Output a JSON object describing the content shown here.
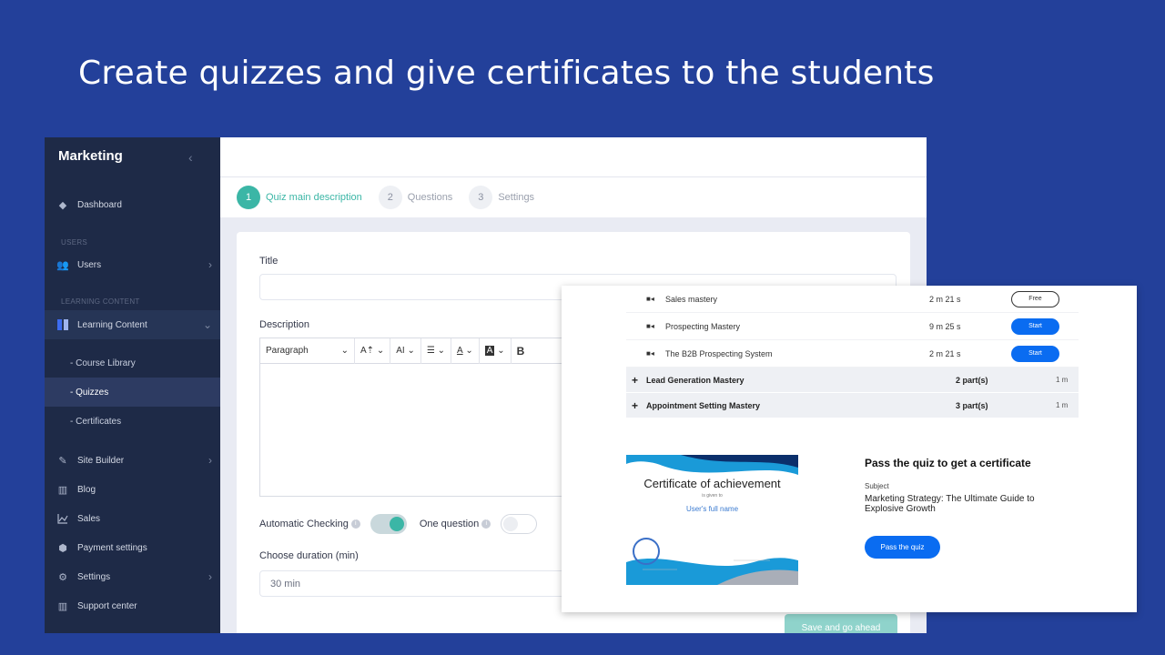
{
  "headline": "Create quizzes and give certificates to the students",
  "sidebar": {
    "brand": "Marketing",
    "section_users": "USERS",
    "section_learning": "LEARNING CONTENT",
    "items": {
      "dashboard": "Dashboard",
      "users": "Users",
      "learning_content": "Learning Content",
      "course_library": "- Course Library",
      "quizzes": "- Quizzes",
      "certificates": "- Certificates",
      "site_builder": "Site Builder",
      "blog": "Blog",
      "sales": "Sales",
      "payment_settings": "Payment settings",
      "settings": "Settings",
      "support_center": "Support center"
    }
  },
  "steps": [
    {
      "num": "1",
      "label": "Quiz main description"
    },
    {
      "num": "2",
      "label": "Questions"
    },
    {
      "num": "3",
      "label": "Settings"
    }
  ],
  "form": {
    "title_label": "Title",
    "description_label": "Description",
    "toolbar": {
      "paragraph": "Paragraph",
      "bold": "B"
    },
    "automatic_checking": "Automatic Checking",
    "one_question": "One question",
    "choose_duration": "Choose duration (min)",
    "duration_value": "30 min",
    "save_button": "Save and go ahead"
  },
  "overlay": {
    "lessons": [
      {
        "name": "Sales mastery",
        "duration": "2 m 21 s",
        "action": "Free"
      },
      {
        "name": "Prospecting Mastery",
        "duration": "9 m 25 s",
        "action": "Start"
      },
      {
        "name": "The B2B Prospecting System",
        "duration": "2 m 21 s",
        "action": "Start"
      }
    ],
    "modules": [
      {
        "name": "Lead Generation Mastery",
        "parts": "2 part(s)",
        "duration": "1 m"
      },
      {
        "name": "Appointment Setting Mastery",
        "parts": "3 part(s)",
        "duration": "1 m"
      }
    ],
    "certificate": {
      "title": "Certificate of achievement",
      "given": "is given to",
      "name": "User's full name"
    },
    "cta_title": "Pass the quiz to get a certificate",
    "subject_label": "Subject",
    "subject": "Marketing Strategy: The Ultimate Guide to Explosive Growth",
    "pass_button": "Pass the quiz"
  },
  "colors": {
    "background": "#23409a",
    "sidebar": "#1e2a47",
    "accent": "#3bb6a6",
    "primary_button": "#0a6cf1"
  }
}
